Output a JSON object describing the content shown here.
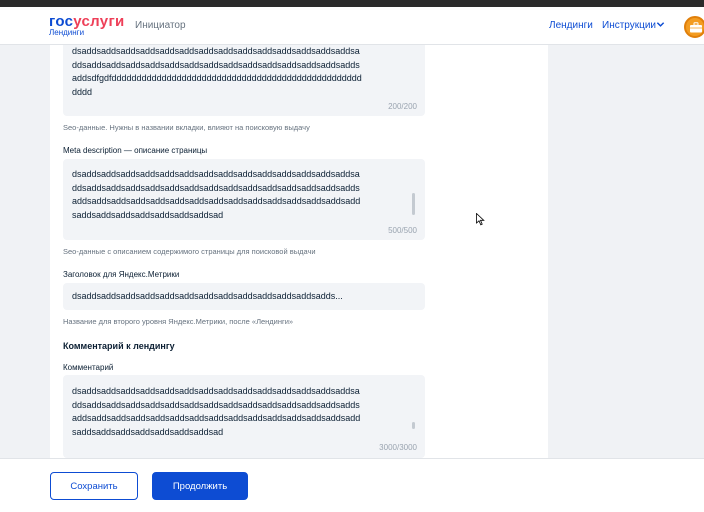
{
  "header": {
    "logo_part1": "гос",
    "logo_part2": "услуги",
    "logo_sub": "Лендинги",
    "role": "Инициатор",
    "nav": {
      "landings": "Лендинги",
      "instructions": "Инструкции"
    }
  },
  "seo_title": {
    "text": "dsaddsaddsaddsaddsaddsaddsaddsaddsaddsaddsaddsaddsaddsaddsaddsaddsaddsaddsaddsaddsaddsaddsaddsaddsaddsaddsaddsaddsaddsaddsdfgdfdddddddddddddddddddddddddddddddddddddddddddddddddddddd",
    "counter": "200/200",
    "hint": "Seo-данные. Нужны в названии вкладки, влияют на поисковую выдачу"
  },
  "meta_description": {
    "label": "Meta description — описание страницы",
    "text": "dsaddsaddsaddsaddsaddsaddsaddsaddsaddsaddsaddsaddsaddsaddsaddsaddsaddsaddsaddsaddsaddsaddsaddsaddsaddsaddsaddsaddsaddsaddsaddsaddsaddsaddsaddsaddsaddsaddsaddsaddsaddsaddsaddsaddsaddsaddsaddsaddsaddsaddsaddsad",
    "counter": "500/500",
    "hint": "Seo-данные с описанием содержимого страницы для поисковой выдачи"
  },
  "metrika_title": {
    "label": "Заголовок для Яндекс.Метрики",
    "value": "dsaddsaddsaddsaddsaddsaddsaddsaddsaddsaddsaddsaddsadds...",
    "hint": "Название для второго уровня Яндекс.Метрики, после «Лендинги»"
  },
  "comment_section": {
    "title": "Комментарий к лендингу",
    "label": "Комментарий",
    "text": "dsaddsaddsaddsaddsaddsaddsaddsaddsaddsaddsaddsaddsaddsaddsaddsaddsaddsaddsaddsaddsaddsaddsaddsaddsaddsaddsaddsaddsaddsaddsaddsaddsaddsaddsaddsaddsaddsaddsaddsaddsaddsaddsaddsaddsaddsaddsaddsaddsaddsaddsaddsad",
    "counter": "3000/3000"
  },
  "footer": {
    "save_label": "Сохранить",
    "continue_label": "Продолжить"
  },
  "colors": {
    "brand_blue": "#0d4cd3",
    "brand_red": "#ee3f58",
    "avatar_orange": "#f39c21"
  }
}
